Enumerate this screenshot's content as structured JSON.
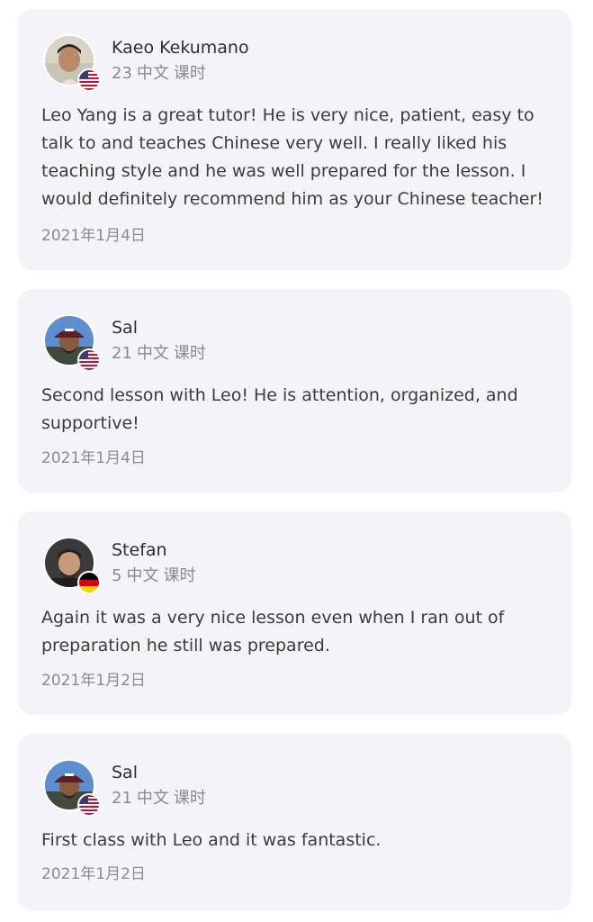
{
  "reviews": [
    {
      "name": "Kaeo Kekumano",
      "lesson_count": "23",
      "language": "中文",
      "unit": "课时",
      "country_flag": "us-flag-icon",
      "text": "Leo Yang is a great tutor! He is very nice, patient, easy to talk to and teaches Chinese very well. I really liked his teaching style and he was well prepared for the lesson. I would definitely recommend him as your Chinese teacher!",
      "date": "2021年1月4日"
    },
    {
      "name": "Sal",
      "lesson_count": "21",
      "language": "中文",
      "unit": "课时",
      "country_flag": "us-flag-icon",
      "text": "Second lesson with Leo! He is attention, organized, and supportive!",
      "date": "2021年1月4日"
    },
    {
      "name": "Stefan",
      "lesson_count": "5",
      "language": "中文",
      "unit": "课时",
      "country_flag": "de-flag-icon",
      "text": "Again it was a very nice lesson even when I ran out of preparation he still was prepared.",
      "date": "2021年1月2日"
    },
    {
      "name": "Sal",
      "lesson_count": "21",
      "language": "中文",
      "unit": "课时",
      "country_flag": "us-flag-icon",
      "text": "First class with Leo and it was fantastic.",
      "date": "2021年1月2日"
    }
  ],
  "colors": {
    "card_background": "#f4f4f8",
    "text_primary": "#2d2d3a",
    "text_secondary": "#8a8a96"
  }
}
